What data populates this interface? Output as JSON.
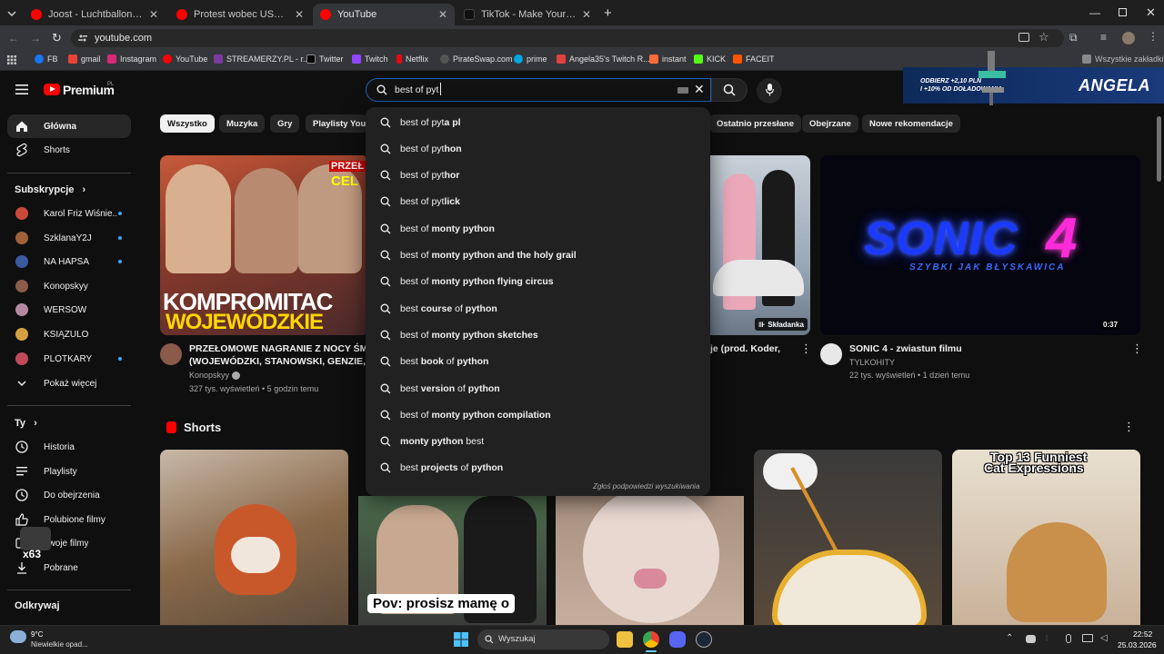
{
  "browser": {
    "tabs": [
      {
        "title": "Joost - Luchtballon (Official Vid...",
        "favicon_color": "#ff0000"
      },
      {
        "title": "Protest wobec USA i zlot Kamr...",
        "favicon_color": "#ff0000"
      },
      {
        "title": "YouTube",
        "favicon_color": "#ff0000"
      },
      {
        "title": "TikTok - Make Your Day",
        "favicon_color": "#111111"
      }
    ],
    "url": "youtube.com",
    "bookmarks": [
      "FB",
      "gmail",
      "Instagram",
      "YouTube",
      "STREAMERZY.PL - r...",
      "Twitter",
      "Twitch",
      "Netflix",
      "PirateSwap.com",
      "prime",
      "Angela35's Twitch R...",
      "instant",
      "KICK",
      "FACEIT",
      "Wszystkie zakładki"
    ]
  },
  "ad_banner": {
    "line1": "ODBIERZ +2,10 PLN",
    "line2": "I +10% OD DOŁADOWANIA",
    "brand": "ANGELA"
  },
  "youtube": {
    "logo_text": "Premium",
    "logo_region": "PL",
    "search_value": "best of pyt",
    "suggestions": [
      {
        "prefix": "best of pyt",
        "rest": "a pl"
      },
      {
        "prefix": "best of pyt",
        "rest": "hon"
      },
      {
        "prefix": "best of pyt",
        "rest": "hor"
      },
      {
        "prefix": "best of pyt",
        "rest": "lick"
      },
      {
        "prefix": "best of ",
        "rest": "monty python"
      },
      {
        "prefix": "best of ",
        "rest": "monty python and the holy grail"
      },
      {
        "prefix": "best of ",
        "rest": "monty python flying circus"
      },
      {
        "prefix": "best ",
        "rest": "course",
        "tail": " of ",
        "rest2": "python"
      },
      {
        "prefix": "best of ",
        "rest": "monty python sketches"
      },
      {
        "prefix": "best ",
        "rest": "book",
        "tail": " of ",
        "rest2": "python"
      },
      {
        "prefix": "best ",
        "rest": "version",
        "tail": " of ",
        "rest2": "python"
      },
      {
        "prefix": "best of ",
        "rest": "monty python compilation"
      },
      {
        "prefix": "",
        "rest": "monty python",
        "tail": " best"
      },
      {
        "prefix": "best ",
        "rest": "projects",
        "tail": " of ",
        "rest2": "python"
      }
    ],
    "report_text": "Zgłoś podpowiedzi wyszukiwania",
    "sidebar": {
      "main": [
        {
          "label": "Główna",
          "icon": "home-icon"
        },
        {
          "label": "Shorts",
          "icon": "shorts-icon"
        }
      ],
      "subs_header": "Subskrypcje",
      "subs": [
        {
          "label": "Karol Friz Wiśnie...",
          "color": "#c94a3a"
        },
        {
          "label": "SzklanaY2J",
          "color": "#a0603a"
        },
        {
          "label": "NA HAPSA",
          "color": "#3a5aa0"
        },
        {
          "label": "Konopskyy",
          "color": "#8a5a4a"
        },
        {
          "label": "WERSOW",
          "color": "#b48aa0"
        },
        {
          "label": "KSIĄŻULO",
          "color": "#d6a040"
        },
        {
          "label": "PLOTKARY",
          "color": "#c04a5a"
        }
      ],
      "show_more": "Pokaż więcej",
      "you_header": "Ty",
      "you": [
        {
          "label": "Historia",
          "icon": "history-icon"
        },
        {
          "label": "Playlisty",
          "icon": "playlist-icon"
        },
        {
          "label": "Do obejrzenia",
          "icon": "clock-icon"
        },
        {
          "label": "Polubione filmy",
          "icon": "like-icon"
        },
        {
          "label": "Twoje filmy",
          "icon": "video-icon"
        },
        {
          "label": "Pobrane",
          "icon": "download-icon"
        }
      ],
      "explore_header": "Odkrywaj",
      "overlay_badge": "x63"
    },
    "chips": [
      "Wszystko",
      "Muzyka",
      "Gry",
      "Playlisty YouT",
      "Ostatnio przesłane",
      "Obejrzane",
      "Nowe rekomendacje"
    ],
    "videos": [
      {
        "title_line1": "PRZEŁOMOWE NAGRANIE Z NOCY ŚMIE",
        "title_line2": "(WOJEWÓDZKI, STANOWSKI, GENZIE, NA",
        "channel": "Konopskyy",
        "meta": "327 tys. wyświetleń • 5 godzin temu",
        "thumb_text1": "KOMPROMITAC",
        "thumb_text2": "WOJEWÓDZKIE",
        "thumb_text3": "PRZEŁ",
        "thumb_text4": "CEL"
      },
      {
        "title_line1": "je (prod. Koder,",
        "badge": "Składanka"
      },
      {
        "title": "SONIC 4 - zwiastun filmu",
        "channel": "TYLKOHITY",
        "meta": "22 tys. wyświetleń • 1 dzień temu",
        "duration": "0:37",
        "thumb_text1": "SONIC",
        "thumb_text2": "4",
        "thumb_text3": "SZYBKI JAK BŁYSKAWICA"
      }
    ],
    "shorts_header": "Shorts",
    "shorts": [
      {
        "color": "#8a6a4a",
        "caption": ""
      },
      {
        "color": "#5a4a3a",
        "caption": "Pov: prosisz mamę o"
      },
      {
        "color": "#b8a090",
        "caption": ""
      },
      {
        "color": "#c8b080",
        "caption": ""
      },
      {
        "color": "#d0c0a0",
        "caption_line1": "Top 13 Funniest",
        "caption_line2": "Cat Expressions"
      }
    ]
  },
  "taskbar": {
    "weather_temp": "9°C",
    "weather_desc": "Niewielkie opad...",
    "search_placeholder": "Wyszukaj",
    "time": "22:52",
    "date": "25.03.2026"
  }
}
